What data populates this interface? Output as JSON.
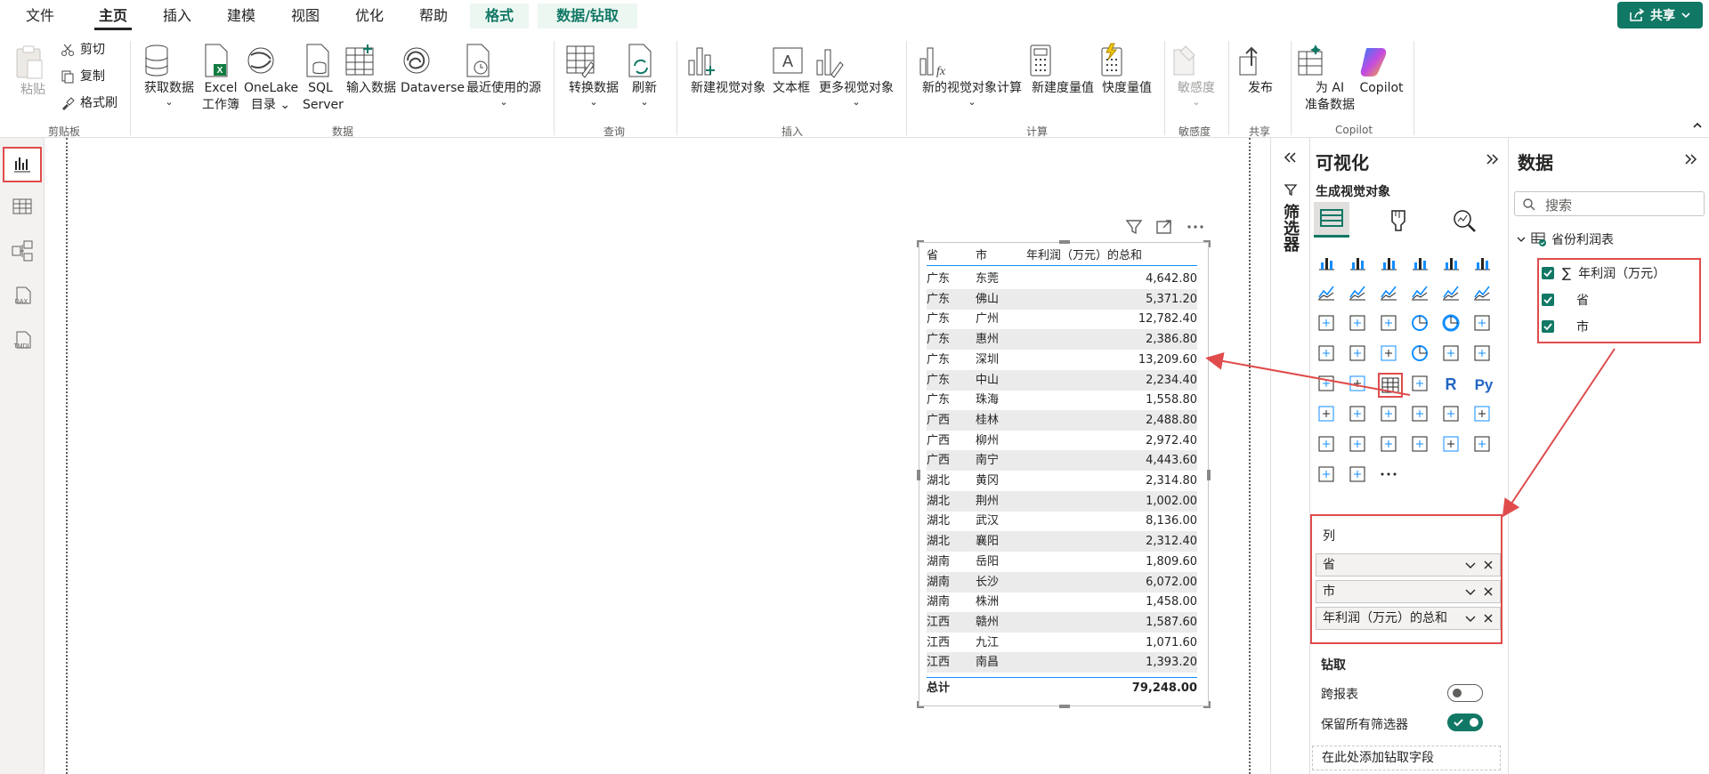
{
  "tabs": [
    {
      "label": "文件"
    },
    {
      "label": "主页"
    },
    {
      "label": "插入"
    },
    {
      "label": "建模"
    },
    {
      "label": "视图"
    },
    {
      "label": "优化"
    },
    {
      "label": "帮助"
    },
    {
      "label": "格式"
    },
    {
      "label": "数据/钻取"
    }
  ],
  "share_label": "共享",
  "ribbon": {
    "paste": "粘贴",
    "cut": "剪切",
    "copy": "复制",
    "format_painter": "格式刷",
    "get_data": "获取数据",
    "excel": "Excel",
    "excel2": "工作簿",
    "onelake": "OneLake",
    "onelake2": "目录",
    "sql": "SQL",
    "sql2": "Server",
    "enter_data": "输入数据",
    "dataverse": "Dataverse",
    "recent": "最近使用的源",
    "transform": "转换数据",
    "refresh": "刷新",
    "new_visual": "新建视觉对象",
    "textbox": "文本框",
    "more_visuals": "更多视觉对象",
    "new_calc": "新的视觉对象计算",
    "new_measure": "新建度量值",
    "quick_measure": "快度量值",
    "sensitivity": "敏感度",
    "publish": "发布",
    "ai_prep": "为 AI",
    "ai_prep2": "准备数据",
    "copilot": "Copilot",
    "groups": {
      "clipboard": "剪贴板",
      "data": "数据",
      "query": "查询",
      "insert": "插入",
      "calc": "计算",
      "sensitivity": "敏感度",
      "share": "共享",
      "copilot": "Copilot"
    }
  },
  "table": {
    "headers": [
      "省",
      "市",
      "年利润（万元）的总和"
    ],
    "rows": [
      [
        "广东",
        "东莞",
        "4,642.80"
      ],
      [
        "广东",
        "佛山",
        "5,371.20"
      ],
      [
        "广东",
        "广州",
        "12,782.40"
      ],
      [
        "广东",
        "惠州",
        "2,386.80"
      ],
      [
        "广东",
        "深圳",
        "13,209.60"
      ],
      [
        "广东",
        "中山",
        "2,234.40"
      ],
      [
        "广东",
        "珠海",
        "1,558.80"
      ],
      [
        "广西",
        "桂林",
        "2,488.80"
      ],
      [
        "广西",
        "柳州",
        "2,972.40"
      ],
      [
        "广西",
        "南宁",
        "4,443.60"
      ],
      [
        "湖北",
        "黄冈",
        "2,314.80"
      ],
      [
        "湖北",
        "荆州",
        "1,002.00"
      ],
      [
        "湖北",
        "武汉",
        "8,136.00"
      ],
      [
        "湖北",
        "襄阳",
        "2,312.40"
      ],
      [
        "湖南",
        "岳阳",
        "1,809.60"
      ],
      [
        "湖南",
        "长沙",
        "6,072.00"
      ],
      [
        "湖南",
        "株洲",
        "1,458.00"
      ],
      [
        "江西",
        "赣州",
        "1,587.60"
      ],
      [
        "江西",
        "九江",
        "1,071.60"
      ],
      [
        "江西",
        "南昌",
        "1,393.20"
      ]
    ],
    "total_label": "总计",
    "total_value": "79,248.00"
  },
  "filters_label": "筛选器",
  "viz": {
    "title": "可视化",
    "subtitle": "生成视觉对象",
    "columns_label": "列",
    "fields": [
      "省",
      "市",
      "年利润（万元）的总和"
    ],
    "drill_label": "钻取",
    "cross_report": "跨报表",
    "keep_filters": "保留所有筛选器",
    "drill_add": "在此处添加钻取字段"
  },
  "data_pane": {
    "title": "数据",
    "search_placeholder": "搜索",
    "table_name": "省份利润表",
    "fields": [
      "年利润（万元）",
      "省",
      "市"
    ]
  },
  "colors": {
    "accent": "#117865",
    "highlight": "#e04c4c",
    "check": "#117865"
  }
}
